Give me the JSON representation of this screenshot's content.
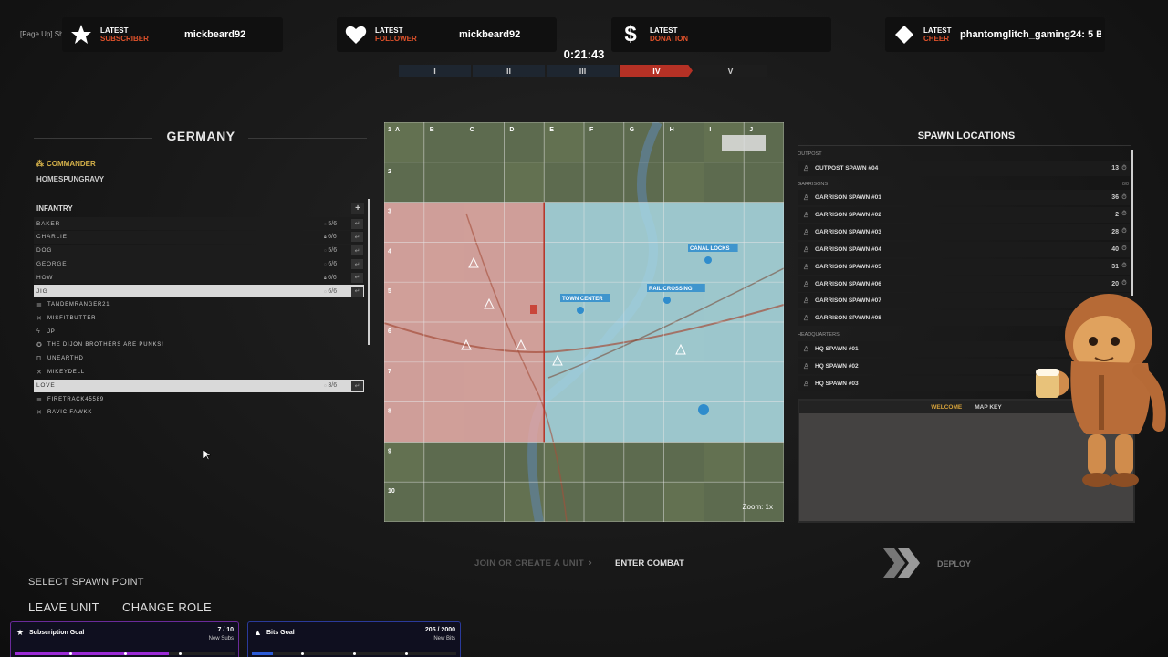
{
  "overlay": {
    "page_up_hint": "[Page Up] Sho",
    "alerts": [
      {
        "title_a": "LATEST",
        "title_b": "SUBSCRIBER",
        "value": "mickbeard92",
        "icon": "star-icon"
      },
      {
        "title_a": "LATEST",
        "title_b": "FOLLOWER",
        "value": "mickbeard92",
        "icon": "heart-icon"
      },
      {
        "title_a": "LATEST",
        "title_b": "DONATION",
        "value": "",
        "icon": "dollar-icon"
      },
      {
        "title_a": "LATEST",
        "title_b": "CHEER",
        "value": "phantomglitch_gaming24: 5 B",
        "icon": "diamond-icon"
      }
    ],
    "goals": [
      {
        "title": "Subscription Goal",
        "value": "7 / 10",
        "sub": "New Subs",
        "progress": 0.7,
        "color": "#9b2bd6"
      },
      {
        "title": "Bits Goal",
        "value": "205 / 2000",
        "sub": "New Bits",
        "progress": 0.1025,
        "color": "#2b5bd6"
      }
    ]
  },
  "match": {
    "timer": "0:21:43",
    "phases": [
      "I",
      "II",
      "III",
      "IV",
      "V"
    ],
    "active_phase": 3
  },
  "team": {
    "name": "GERMANY",
    "commander_label": "COMMANDER",
    "commander_name": "HOMESPUNGRAVY",
    "squad_type": "INFANTRY",
    "add_label": "+",
    "units": [
      {
        "name": "BAKER",
        "count": "5/6",
        "locked": false,
        "type": "unit"
      },
      {
        "name": "CHARLIE",
        "count": "6/6",
        "locked": true,
        "type": "unit"
      },
      {
        "name": "DOG",
        "count": "5/6",
        "locked": false,
        "type": "unit"
      },
      {
        "name": "GEORGE",
        "count": "6/6",
        "locked": false,
        "type": "unit"
      },
      {
        "name": "HOW",
        "count": "6/6",
        "locked": true,
        "type": "unit"
      },
      {
        "name": "JIG",
        "count": "6/6",
        "locked": false,
        "type": "selected"
      },
      {
        "name": "TANDEMRANGER21",
        "type": "member",
        "icon": "≣"
      },
      {
        "name": "MISFITBUTTER",
        "type": "member",
        "icon": "✕"
      },
      {
        "name": "JP",
        "type": "member",
        "icon": "ϟ"
      },
      {
        "name": "THE DIJON BROTHERS ARE PUNKS!",
        "type": "member",
        "icon": "✪"
      },
      {
        "name": "UNEARTHD",
        "type": "member",
        "icon": "Π"
      },
      {
        "name": "MIKEYDELL",
        "type": "member",
        "icon": "✕"
      },
      {
        "name": "LOVE",
        "count": "3/6",
        "locked": false,
        "type": "selected"
      },
      {
        "name": "FIRETRACK45589",
        "type": "member",
        "icon": "≣"
      },
      {
        "name": "RAVIC FAWKK",
        "type": "member",
        "icon": "✕"
      }
    ]
  },
  "map": {
    "columns": [
      "A",
      "B",
      "C",
      "D",
      "E",
      "F",
      "G",
      "H",
      "I",
      "J"
    ],
    "rows": [
      "1",
      "2",
      "3",
      "4",
      "5",
      "6",
      "7",
      "8",
      "9",
      "10"
    ],
    "labels": [
      "TOWN CENTER",
      "RAIL CROSSING",
      "CANAL LOCKS"
    ],
    "zoom": "Zoom: 1x",
    "enemy_color": "#e8a9a9",
    "friendly_color": "#a9dbe8"
  },
  "spawns": {
    "title": "SPAWN LOCATIONS",
    "outpost_label": "OUTPOST",
    "garrison_label": "GARRISONS",
    "garrison_count": "8/8",
    "hq_label": "HEADQUARTERS",
    "outpost": [
      {
        "name": "OUTPOST SPAWN #04",
        "count": "13"
      }
    ],
    "garrisons": [
      {
        "name": "GARRISON SPAWN #01",
        "count": "36"
      },
      {
        "name": "GARRISON SPAWN #02",
        "count": "2"
      },
      {
        "name": "GARRISON SPAWN #03",
        "count": "28"
      },
      {
        "name": "GARRISON SPAWN #04",
        "count": "40"
      },
      {
        "name": "GARRISON SPAWN #05",
        "count": "31"
      },
      {
        "name": "GARRISON SPAWN #06",
        "count": "20"
      },
      {
        "name": "GARRISON SPAWN #07",
        "count": ""
      },
      {
        "name": "GARRISON SPAWN #08",
        "count": ""
      }
    ],
    "hq": [
      {
        "name": "HQ SPAWN #01"
      },
      {
        "name": "HQ SPAWN #02"
      },
      {
        "name": "HQ SPAWN #03"
      }
    ],
    "tabs": {
      "welcome": "WELCOME",
      "map_key": "MAP KEY"
    }
  },
  "footer": {
    "join_label": "JOIN OR CREATE A UNIT",
    "enter_label": "ENTER COMBAT",
    "deploy_label": "DEPLOY",
    "select_spawn": "SELECT SPAWN POINT",
    "leave_unit": "LEAVE UNIT",
    "change_role": "CHANGE ROLE"
  }
}
